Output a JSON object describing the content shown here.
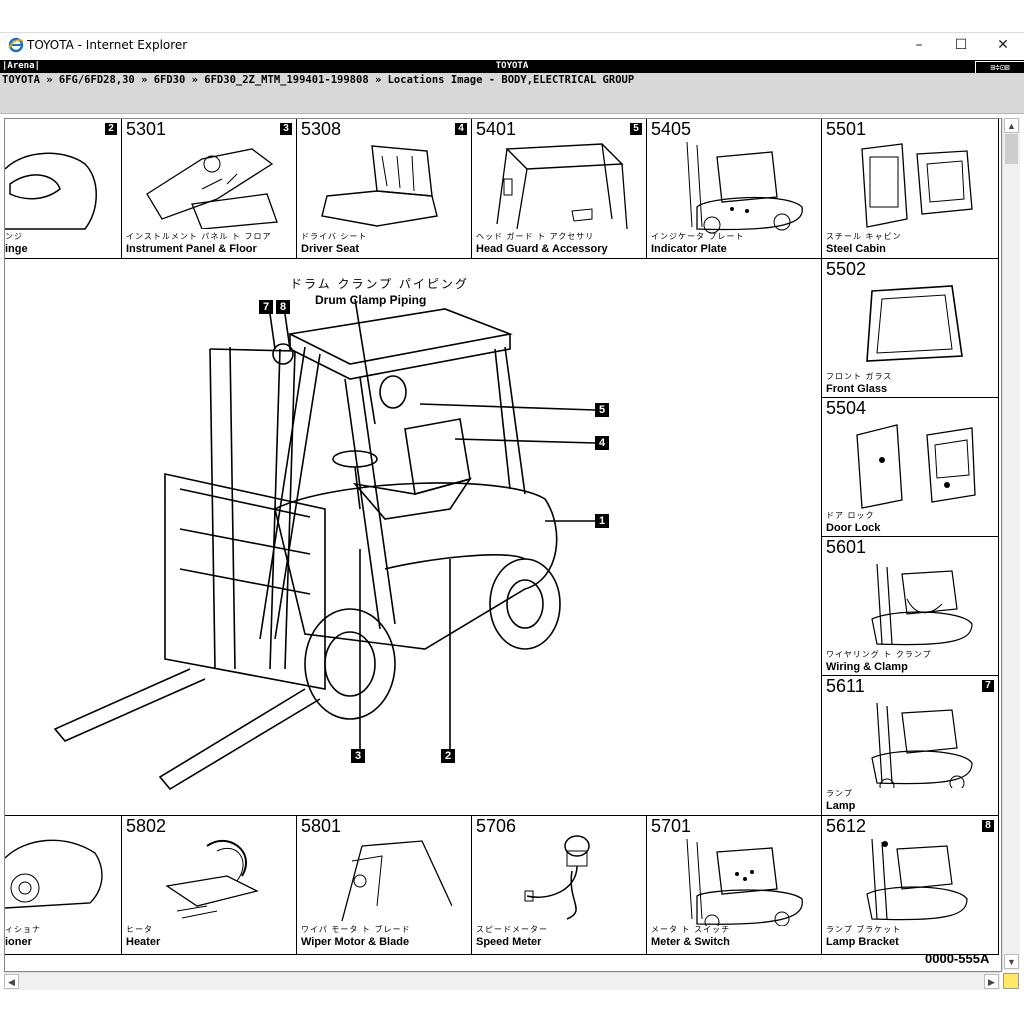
{
  "window": {
    "title": "TOYOTA - Internet Explorer",
    "minimize": "–",
    "maximize": "☐",
    "close": "✕"
  },
  "header": {
    "left": "|Arena|",
    "center": "TOYOTA",
    "icons": "⊞≑⊡⊠"
  },
  "breadcrumb": "TOYOTA » 6FG/6FD28,30 » 6FD30 » 6FD30_2Z_MTM_199401-199808 » Locations Image - BODY,ELECTRICAL GROUP",
  "top_row": [
    {
      "num": "",
      "tag": "2",
      "jp": "ンジ",
      "en": "inge"
    },
    {
      "num": "5301",
      "tag": "3",
      "jp": "インストルメント パネル ト フロア",
      "en": "Instrument Panel & Floor"
    },
    {
      "num": "5308",
      "tag": "4",
      "jp": "ドライバ シート",
      "en": "Driver Seat"
    },
    {
      "num": "5401",
      "tag": "5",
      "jp": "ヘッド ガード ト アクセサリ",
      "en": "Head Guard & Accessory"
    },
    {
      "num": "5405",
      "tag": "",
      "jp": "インジケータ プレート",
      "en": "Indicator Plate"
    },
    {
      "num": "5501",
      "tag": "",
      "jp": "スチール キャビン",
      "en": "Steel Cabin"
    }
  ],
  "right_col": [
    {
      "num": "5502",
      "tag": "",
      "jp": "フロント ガラス",
      "en": "Front Glass"
    },
    {
      "num": "5504",
      "tag": "",
      "jp": "ドア ロック",
      "en": "Door Lock"
    },
    {
      "num": "5601",
      "tag": "",
      "jp": "ワイヤリング ト クランプ",
      "en": "Wiring & Clamp"
    },
    {
      "num": "5611",
      "tag": "7",
      "jp": "ランプ",
      "en": "Lamp"
    }
  ],
  "bottom_row": [
    {
      "num": "",
      "tag": "",
      "jp": "ィショナ",
      "en": "ioner"
    },
    {
      "num": "5802",
      "tag": "",
      "jp": "ヒータ",
      "en": "Heater"
    },
    {
      "num": "5801",
      "tag": "",
      "jp": "ワイパ モータ ト ブレード",
      "en": "Wiper Motor & Blade"
    },
    {
      "num": "5706",
      "tag": "",
      "jp": "スピードメーター",
      "en": "Speed Meter"
    },
    {
      "num": "5701",
      "tag": "",
      "jp": "メータ ト スイッチ",
      "en": "Meter & Switch"
    },
    {
      "num": "5612",
      "tag": "8",
      "jp": "ランプ ブラケット",
      "en": "Lamp Bracket"
    }
  ],
  "main": {
    "jp_title": "ドラム クランプ パイピング",
    "en_title": "Drum Clamp Piping",
    "callouts": [
      "7",
      "8",
      "5",
      "4",
      "1",
      "3",
      "2"
    ]
  },
  "figure_code": "0000-555A"
}
